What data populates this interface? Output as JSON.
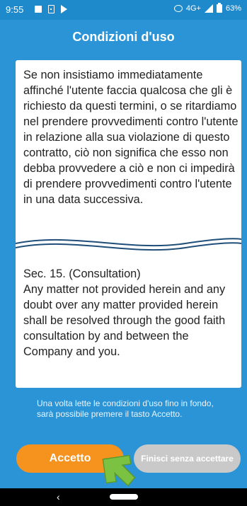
{
  "status": {
    "time": "9:55",
    "network": "4G+",
    "battery": "63%"
  },
  "header": {
    "title": "Condizioni d'uso"
  },
  "content": {
    "italian_paragraph": "Se non insistiamo immediatamente affinché l'utente faccia qualcosa che gli è richiesto da questi termini, o se ritardiamo nel prendere provvedimenti contro l'utente in relazione alla sua violazione di questo contratto, ciò non significa che esso non debba provvedere a ciò e non ci impedirà di prendere provvedimenti contro l'utente in una data successiva.",
    "english_section": "Sec. 15. (Consultation)",
    "english_paragraph": "Any matter not provided herein and any doubt over any matter provided herein shall be resolved through the good faith consultation by and between the Company and you."
  },
  "notice": "Una volta lette le condizioni d'uso fino in fondo, sarà possibile premere il tasto Accetto.",
  "buttons": {
    "accept": "Accetto",
    "finish_without_accepting": "Finisci senza accettare"
  },
  "nav": {
    "back_symbol": "‹"
  }
}
